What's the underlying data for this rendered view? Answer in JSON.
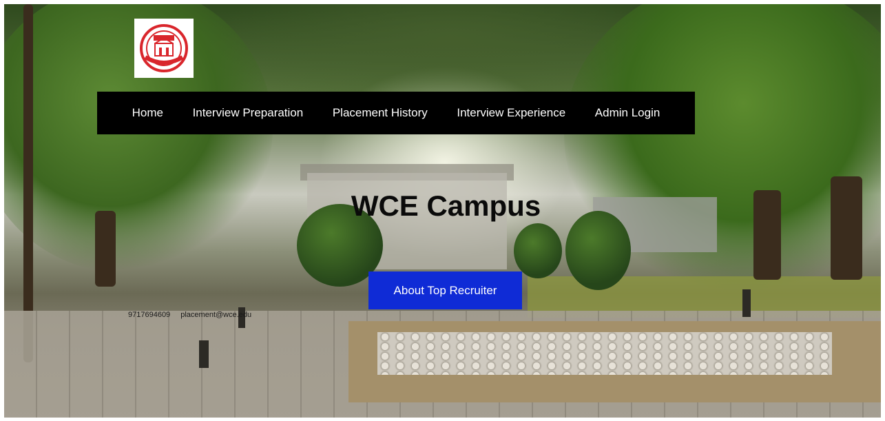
{
  "logo": {
    "icon": "college-emblem-icon",
    "colors": {
      "primary": "#d9262c",
      "background": "#ffffff"
    }
  },
  "nav": {
    "items": [
      {
        "label": "Home"
      },
      {
        "label": "Interview Preparation"
      },
      {
        "label": "Placement History"
      },
      {
        "label": "Interview Experience"
      },
      {
        "label": "Admin Login"
      }
    ]
  },
  "hero": {
    "title": "WCE Campus",
    "button_label": "About Top Recruiter"
  },
  "contact": {
    "phone": "9717694609",
    "email": "placement@wce.edu"
  },
  "colors": {
    "navbar_bg": "#000000",
    "button_bg": "#0f2bd6",
    "button_text": "#ffffff"
  }
}
